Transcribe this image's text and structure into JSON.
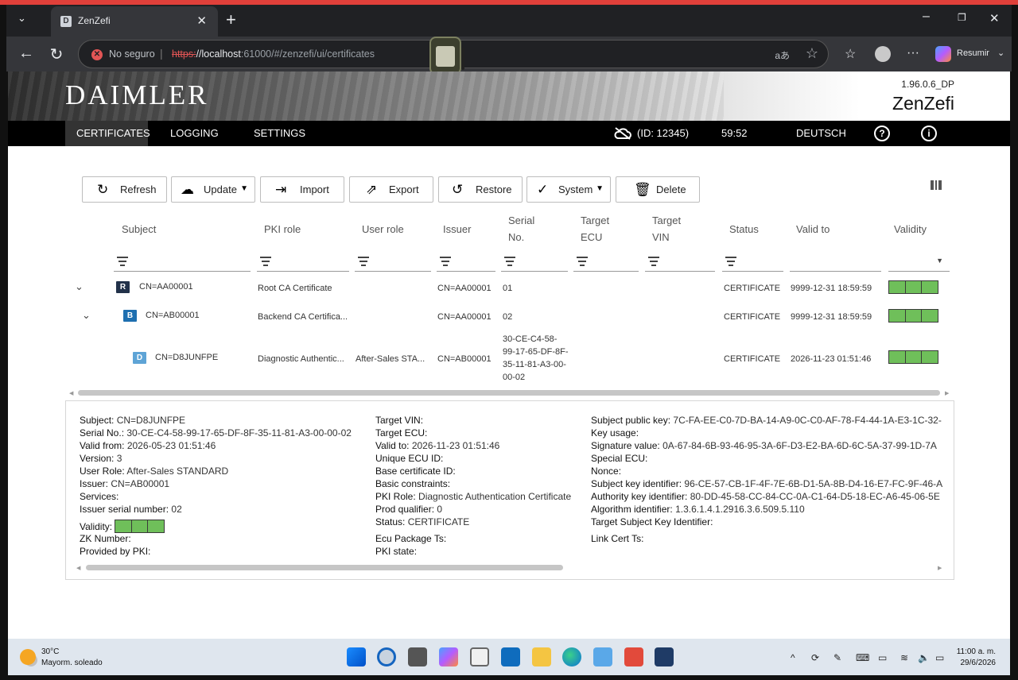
{
  "browser": {
    "tab_title": "ZenZefi",
    "tab_favicon": "D",
    "new_tab": "+",
    "security_label": "No seguro",
    "url_scheme": "https:",
    "url_host": "//localhost",
    "url_rest": ":61000/#/zenzefi/ui/certificates",
    "read_aloud": "aあ",
    "copilot_label": "Resumir"
  },
  "app": {
    "logo": "DAIMLER",
    "version": "1.96.0.6_DP",
    "name": "ZenZefi",
    "nav": {
      "certificates": "CERTIFICATES",
      "logging": "LOGGING",
      "settings": "SETTINGS",
      "session_id": "(ID: 12345)",
      "timer": "59:52",
      "language": "DEUTSCH"
    }
  },
  "toolbar": {
    "refresh": "Refresh",
    "update": "Update",
    "import": "Import",
    "export": "Export",
    "restore": "Restore",
    "system": "System",
    "delete": "Delete"
  },
  "table": {
    "headers": {
      "subject": "Subject",
      "pki_role": "PKI role",
      "user_role": "User role",
      "issuer": "Issuer",
      "serial_1": "Serial",
      "serial_2": "No.",
      "target_ecu_1": "Target",
      "target_ecu_2": "ECU",
      "target_vin_1": "Target",
      "target_vin_2": "VIN",
      "status": "Status",
      "valid_to": "Valid to",
      "validity": "Validity"
    },
    "rows": [
      {
        "icon": "R",
        "subject": "CN=AA00001",
        "pki_role": "Root CA Certificate",
        "user_role": "",
        "issuer": "CN=AA00001",
        "serial": "01",
        "status": "CERTIFICATE",
        "valid_to": "9999-12-31 18:59:59"
      },
      {
        "icon": "B",
        "subject": "CN=AB00001",
        "pki_role": "Backend CA Certifica...",
        "user_role": "",
        "issuer": "CN=AA00001",
        "serial": "02",
        "status": "CERTIFICATE",
        "valid_to": "9999-12-31 18:59:59"
      },
      {
        "icon": "D",
        "subject": "CN=D8JUNFPE",
        "pki_role": "Diagnostic Authentic...",
        "user_role": "After-Sales STA...",
        "issuer": "CN=AB00001",
        "serial_lines": [
          "30-CE-C4-58-",
          "99-17-65-DF-8F-",
          "35-11-81-A3-00-",
          "00-02"
        ],
        "status": "CERTIFICATE",
        "valid_to": "2026-11-23 01:51:46"
      }
    ]
  },
  "detail": {
    "col1": [
      {
        "k": "Subject:",
        "v": "CN=D8JUNFPE"
      },
      {
        "k": "Serial No.:",
        "v": "30-CE-C4-58-99-17-65-DF-8F-35-11-81-A3-00-00-02"
      },
      {
        "k": "Valid from:",
        "v": "2026-05-23 01:51:46"
      },
      {
        "k": "Version:",
        "v": "3"
      },
      {
        "k": "User Role:",
        "v": "After-Sales STANDARD"
      },
      {
        "k": "Issuer:",
        "v": "CN=AB00001"
      },
      {
        "k": "Services:",
        "v": ""
      },
      {
        "k": "Issuer serial number:",
        "v": "02"
      },
      {
        "k": "Validity:",
        "v": ""
      },
      {
        "k": "ZK Number:",
        "v": ""
      },
      {
        "k": "Provided by PKI:",
        "v": ""
      }
    ],
    "col2": [
      {
        "k": "Target VIN:",
        "v": ""
      },
      {
        "k": "Target ECU:",
        "v": ""
      },
      {
        "k": "Valid to:",
        "v": "2026-11-23 01:51:46"
      },
      {
        "k": "Unique ECU ID:",
        "v": ""
      },
      {
        "k": "Base certificate ID:",
        "v": ""
      },
      {
        "k": "Basic constraints:",
        "v": ""
      },
      {
        "k": "PKI Role:",
        "v": "Diagnostic Authentication Certificate"
      },
      {
        "k": "Prod qualifier:",
        "v": "0"
      },
      {
        "k": "Status:",
        "v": "CERTIFICATE"
      },
      {
        "k": "Ecu Package Ts:",
        "v": ""
      },
      {
        "k": "PKI state:",
        "v": ""
      }
    ],
    "col3": [
      {
        "k": "Subject public key:",
        "v": "7C-FA-EE-C0-7D-BA-14-A9-0C-C0-AF-78-F4-44-1A-E3-1C-32-"
      },
      {
        "k": "Key usage:",
        "v": ""
      },
      {
        "k": "Signature value:",
        "v": "0A-67-84-6B-93-46-95-3A-6F-D3-E2-BA-6D-6C-5A-37-99-1D-7A"
      },
      {
        "k": "Special ECU:",
        "v": ""
      },
      {
        "k": "Nonce:",
        "v": ""
      },
      {
        "k": "Subject key identifier:",
        "v": "96-CE-57-CB-1F-4F-7E-6B-D1-5A-8B-D4-16-E7-FC-9F-46-A"
      },
      {
        "k": "Authority key identifier:",
        "v": "80-DD-45-58-CC-84-CC-0A-C1-64-D5-18-EC-A6-45-06-5E"
      },
      {
        "k": "Algorithm identifier:",
        "v": "1.3.6.1.4.1.2916.3.6.509.5.110"
      },
      {
        "k": "Target Subject Key Identifier:",
        "v": ""
      },
      {
        "k": "Link Cert Ts:",
        "v": ""
      }
    ]
  },
  "taskbar": {
    "temp": "30°C",
    "weather": "Mayorm. soleado",
    "time": "11:00 a. m.",
    "date": "29/6/2026"
  },
  "colors": {
    "validity_green": "#6fbf5a",
    "nav_bg": "#000000",
    "security_red": "#e25555"
  }
}
